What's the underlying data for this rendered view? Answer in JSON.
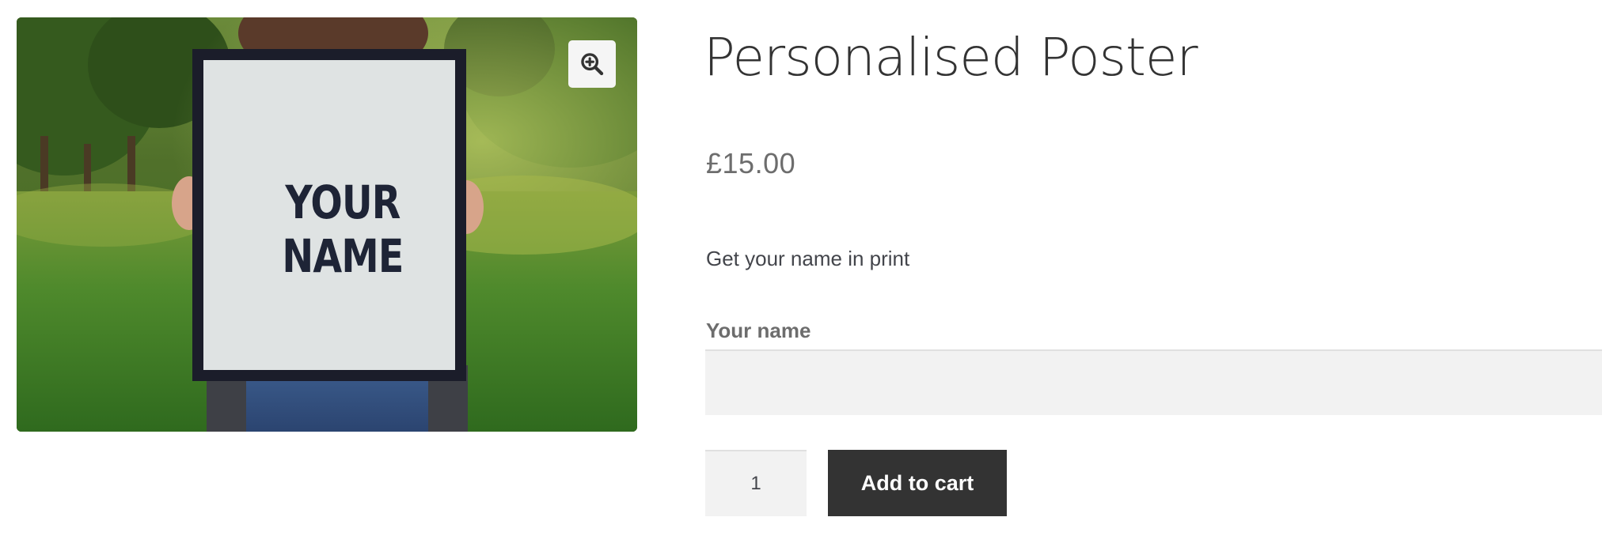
{
  "product": {
    "title": "Personalised Poster",
    "price": "£15.00",
    "short_description": "Get your name in print"
  },
  "gallery": {
    "poster_line_1": "YOUR",
    "poster_line_2": "NAME",
    "zoom_icon": "zoom-in-icon"
  },
  "personalisation": {
    "label": "Your name",
    "value": "",
    "placeholder": ""
  },
  "cart": {
    "quantity": "1",
    "add_to_cart_label": "Add to cart"
  },
  "colors": {
    "button_background": "#333333",
    "input_background": "#f2f2f2",
    "price_text": "#6d6d6d"
  }
}
